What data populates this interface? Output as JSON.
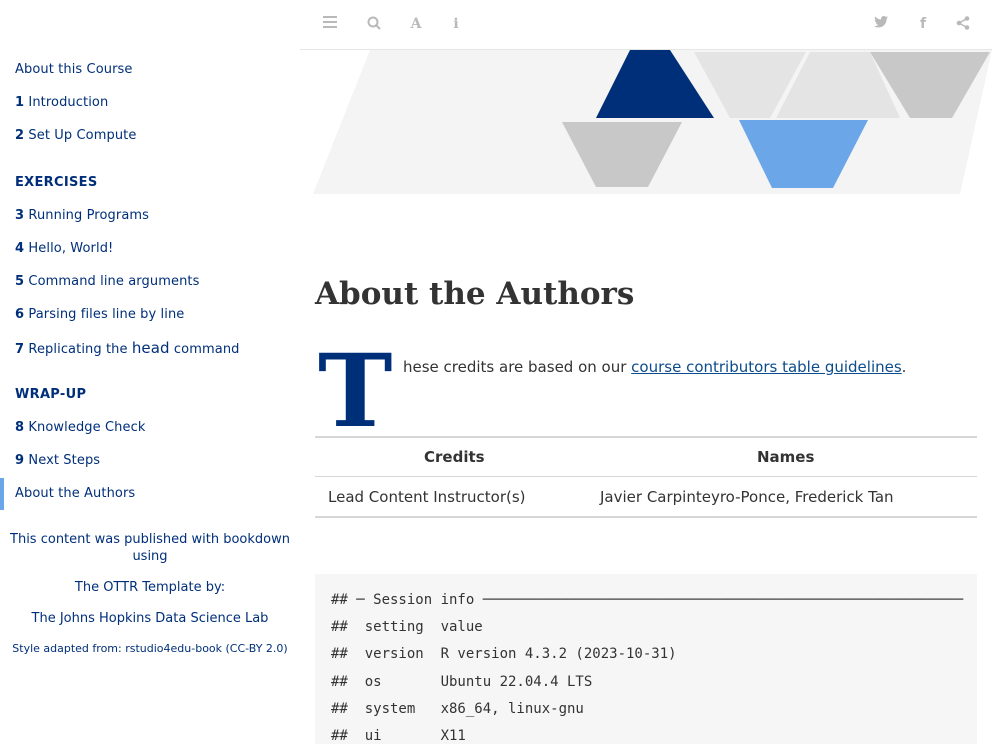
{
  "toolbar": {
    "icons": [
      "menu-icon",
      "search-icon",
      "font-icon",
      "info-icon",
      "twitter-icon",
      "facebook-icon",
      "share-icon"
    ]
  },
  "sidebar": {
    "items": [
      {
        "num": "",
        "label": "About this Course"
      },
      {
        "num": "1",
        "label": "Introduction"
      },
      {
        "num": "2",
        "label": "Set Up Compute"
      }
    ],
    "exercises_heading": "EXERCISES",
    "exercises": [
      {
        "num": "3",
        "label": "Running Programs"
      },
      {
        "num": "4",
        "label": "Hello, World!"
      },
      {
        "num": "5",
        "label": "Command line arguments"
      },
      {
        "num": "6",
        "label": "Parsing files line by line"
      },
      {
        "num": "7",
        "label_pre": "Replicating the ",
        "label_code": "head",
        "label_post": " command"
      }
    ],
    "wrapup_heading": "WRAP-UP",
    "wrapup": [
      {
        "num": "8",
        "label": "Knowledge Check"
      },
      {
        "num": "9",
        "label": "Next Steps"
      },
      {
        "num": "",
        "label": "About the Authors"
      }
    ],
    "footer": {
      "line1a": "This content was published with bookdown",
      "line1b": "using",
      "line2": "The OTTR Template by:",
      "line3": "The Johns Hopkins Data Science Lab",
      "line4": "Style adapted from: rstudio4edu-book (CC-BY 2.0)"
    }
  },
  "main": {
    "title": "About the Authors",
    "dropcap": "T",
    "lead_text": "hese credits are based on our ",
    "lead_link": "course contributors table guidelines",
    "lead_end": ".",
    "table": {
      "headers": [
        "Credits",
        "Names"
      ],
      "rows": [
        [
          "Lead Content Instructor(s)",
          "Javier Carpinteyro-Ponce, Frederick Tan"
        ]
      ]
    },
    "code_lines": [
      "## ─ Session info ─────────────────────────────────────────────────────────",
      "##  setting  value",
      "##  version  R version 4.3.2 (2023-10-31)",
      "##  os       Ubuntu 22.04.4 LTS",
      "##  system   x86_64, linux-gnu",
      "##  ui       X11"
    ]
  },
  "colors": {
    "brand_navy": "#002f7a",
    "accent_light_blue": "#6aa6e8",
    "banner_gray": "#c8c8c8",
    "banner_light": "#e4e4e4",
    "banner_bg": "#f4f4f4"
  }
}
